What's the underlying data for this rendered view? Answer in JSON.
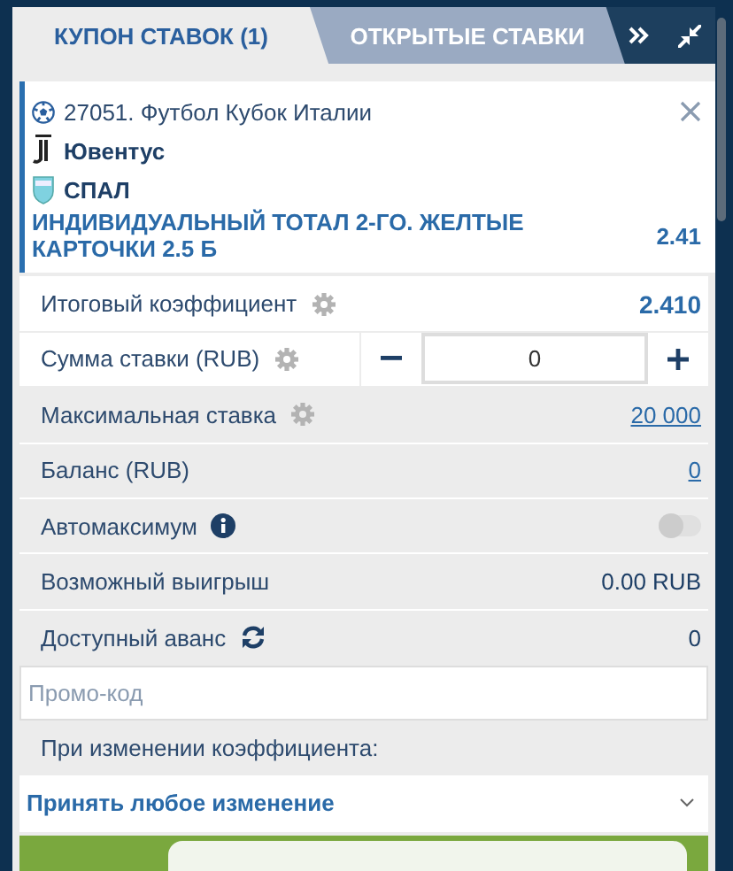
{
  "tabs": [
    {
      "label": "КУПОН СТАВОК (1)",
      "selected": true
    },
    {
      "label": "ОТКРЫТЫЕ СТАВКИ",
      "selected": false
    }
  ],
  "bet": {
    "event": "27051. Футбол Кубок Италии",
    "team_1": "Ювентус",
    "team_2": "СПАЛ",
    "market": "ИНДИВИДУАЛЬНЫЙ ТОТАЛ 2-ГО. ЖЕЛТЫЕ КАРТОЧКИ 2.5 Б",
    "odds": "2.41"
  },
  "total_odds": {
    "label": "Итоговый коэффициент",
    "value": "2.410"
  },
  "stake": {
    "label": "Сумма ставки (RUB)",
    "value": "0"
  },
  "max_stake": {
    "label": "Максимальная ставка",
    "value": "20 000"
  },
  "balance": {
    "label": "Баланс (RUB)",
    "value": "0"
  },
  "auto_max": {
    "label": "Автомаксимум",
    "on": false
  },
  "possible_win": {
    "label": "Возможный выигрыш",
    "value": "0.00 RUB"
  },
  "advance": {
    "label": "Доступный аванс",
    "value": "0"
  },
  "promo": {
    "placeholder": "Промо-код"
  },
  "odds_change": {
    "label": "При изменении коэффициента:",
    "value": "Принять любое изменение"
  }
}
